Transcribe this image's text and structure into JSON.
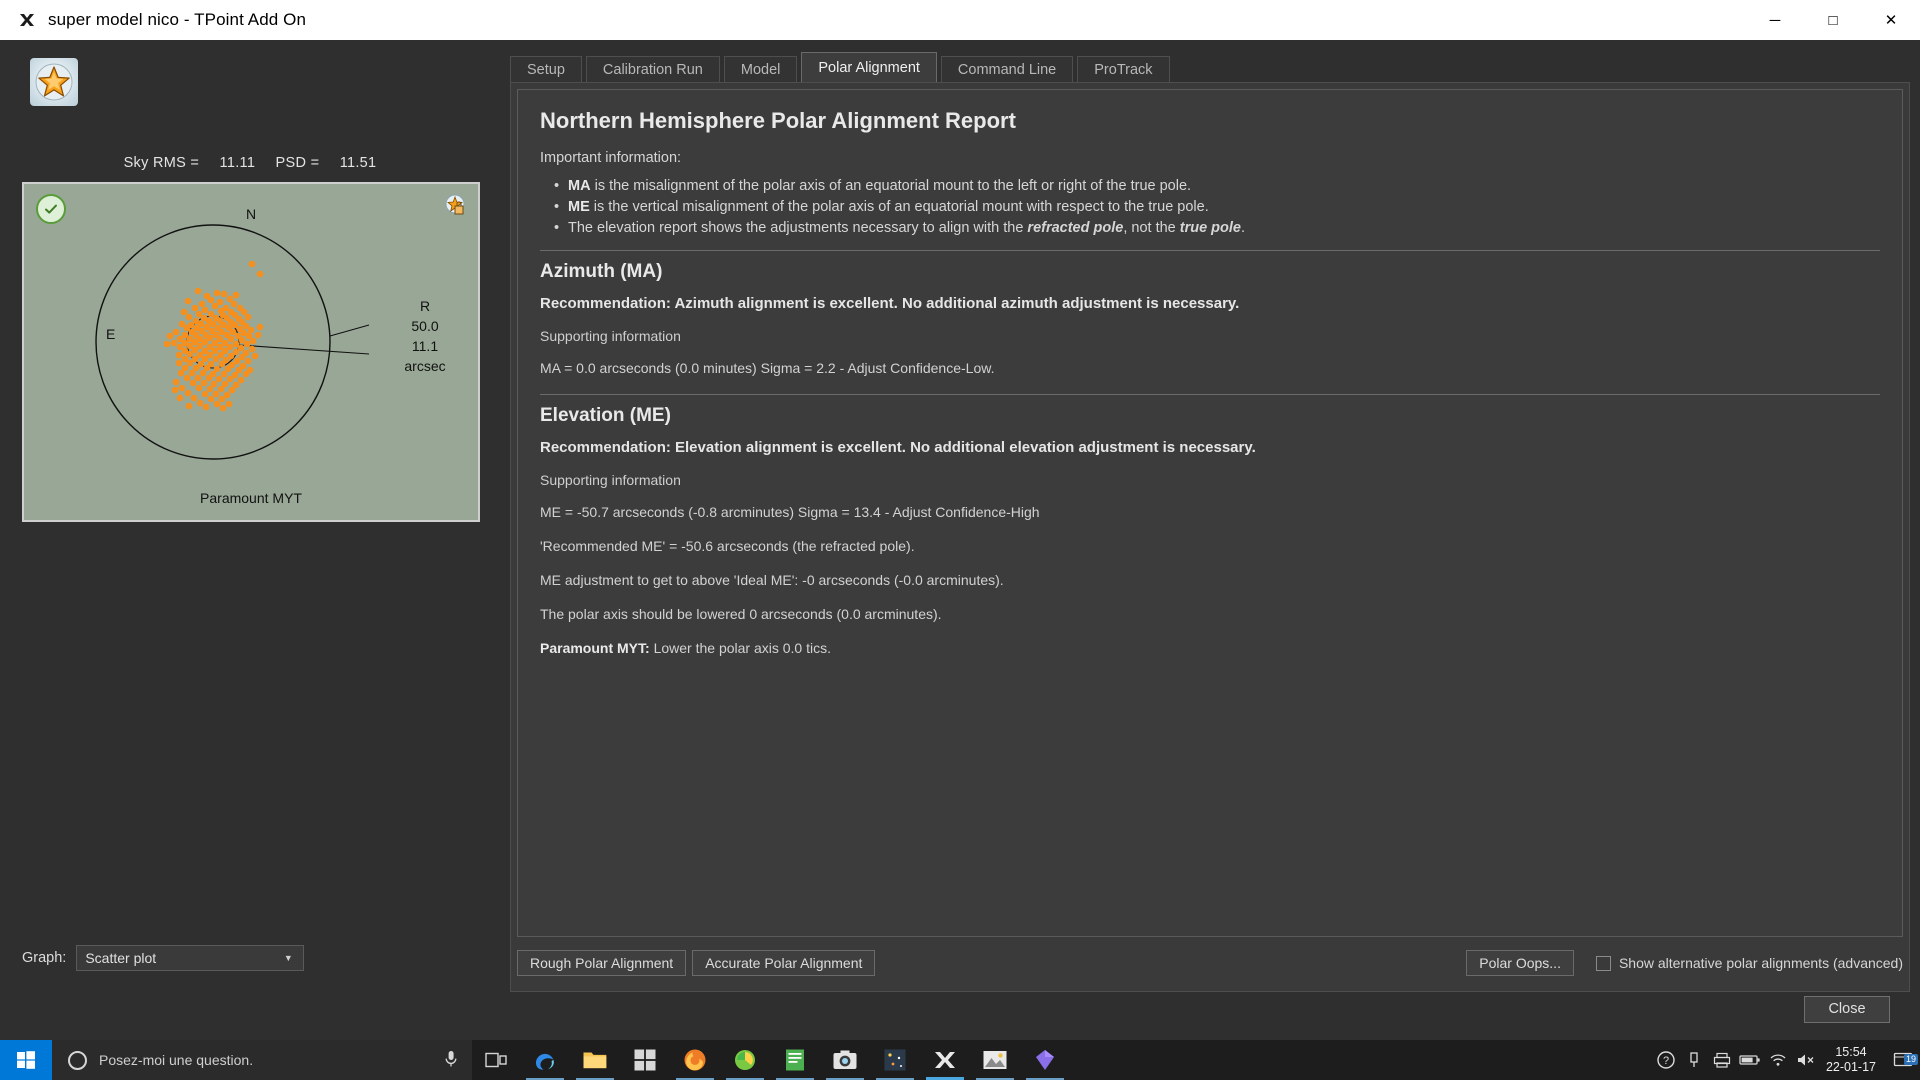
{
  "window": {
    "title": "super model nico - TPoint Add On",
    "icon": "tpoint-x-icon",
    "minimize_label": "─",
    "maximize_label": "□",
    "close_label": "✕"
  },
  "left_panel": {
    "logo_icon": "tpoint-star-logo",
    "stats": {
      "sky_rms_label": "Sky RMS =",
      "sky_rms_value": "11.11",
      "psd_label": "PSD =",
      "psd_value": "11.51"
    },
    "plot": {
      "status_icon": "check-circle-icon",
      "tool_icon": "plot-settings-icon",
      "label_north": "N",
      "label_east": "E",
      "legend_r": "R",
      "legend_outer": "50.0",
      "legend_inner": "11.1",
      "legend_units": "arcsec",
      "caption": "Paramount MYT",
      "background_color": "#99a896",
      "point_color": "#f5901e"
    },
    "graph_selector": {
      "label": "Graph:",
      "value": "Scatter plot",
      "chevron_icon": "chevron-down-icon"
    }
  },
  "tabs": [
    {
      "label": "Setup",
      "active": false
    },
    {
      "label": "Calibration Run",
      "active": false
    },
    {
      "label": "Model",
      "active": false
    },
    {
      "label": "Polar Alignment",
      "active": true
    },
    {
      "label": "Command Line",
      "active": false
    },
    {
      "label": "ProTrack",
      "active": false
    }
  ],
  "report": {
    "title": "Northern Hemisphere Polar Alignment Report",
    "important_label": "Important information:",
    "bullets": [
      {
        "bold": "MA",
        "rest": " is the misalignment of the polar axis of an equatorial mount to the left or right of the true pole."
      },
      {
        "bold": "ME",
        "rest": " is the vertical misalignment of the polar axis of an equatorial mount with respect to the true pole."
      },
      {
        "bold": "",
        "rest": "The elevation report shows the adjustments necessary to align with the ",
        "italic1": "refracted pole",
        "mid": ", not the ",
        "italic2": "true pole",
        "tail": "."
      }
    ],
    "azimuth": {
      "heading": "Azimuth (MA)",
      "recommendation": "Recommendation: Azimuth alignment is excellent. No additional azimuth adjustment is necessary.",
      "supporting_label": "Supporting information",
      "lines": [
        "MA = 0.0 arcseconds (0.0 minutes) Sigma = 2.2 - Adjust Confidence-Low."
      ]
    },
    "elevation": {
      "heading": "Elevation (ME)",
      "recommendation": "Recommendation: Elevation alignment is excellent. No additional elevation adjustment is necessary.",
      "supporting_label": "Supporting information",
      "lines": [
        "ME = -50.7 arcseconds (-0.8 arcminutes) Sigma = 13.4 - Adjust Confidence-High",
        "'Recommended ME' = -50.6 arcseconds (the refracted pole).",
        "ME adjustment to get to above 'Ideal ME': -0 arcseconds (-0.0 arcminutes).",
        "The polar axis should be lowered 0 arcseconds (0.0 arcminutes)."
      ],
      "final_bold": "Paramount MYT:",
      "final_rest": " Lower the polar axis 0.0 tics."
    }
  },
  "bottom_bar": {
    "rough_button": "Rough Polar Alignment",
    "accurate_button": "Accurate Polar Alignment",
    "polar_oops_button": "Polar Oops...",
    "show_alternative_label": "Show alternative polar alignments (advanced)",
    "show_alternative_checked": false
  },
  "dialog_footer": {
    "close_button": "Close"
  },
  "taskbar": {
    "start_icon": "windows-start-icon",
    "search_placeholder": "Posez-moi une question.",
    "search_icon": "search-circle-icon",
    "mic_icon": "microphone-icon",
    "task_view_icon": "task-view-icon",
    "apps": [
      {
        "name": "edge-icon",
        "running": true
      },
      {
        "name": "file-explorer-icon",
        "running": true
      },
      {
        "name": "store-icon",
        "running": false
      },
      {
        "name": "firefox-icon",
        "running": true
      },
      {
        "name": "photo-app-icon",
        "running": true
      },
      {
        "name": "notes-app-icon",
        "running": true
      },
      {
        "name": "camera-app-icon",
        "running": true
      },
      {
        "name": "skychart-app-icon",
        "running": true
      },
      {
        "name": "tpoint-app-icon",
        "active": true
      },
      {
        "name": "image-viewer-icon",
        "running": true
      },
      {
        "name": "gem-app-icon",
        "running": true
      }
    ],
    "tray": [
      {
        "name": "help-icon"
      },
      {
        "name": "usb-icon"
      },
      {
        "name": "printer-icon"
      },
      {
        "name": "battery-icon"
      },
      {
        "name": "wifi-icon"
      },
      {
        "name": "volume-icon"
      }
    ],
    "clock_time": "15:54",
    "clock_date": "22-01-17",
    "notification_icon": "notification-icon",
    "notification_count": "19"
  },
  "chart_data": {
    "type": "scatter",
    "title": "Scatter plot",
    "subtitle": "Paramount MYT",
    "annotations": {
      "sky_rms": 11.11,
      "psd": 11.51
    },
    "axis_labels": {
      "top": "N",
      "left": "E"
    },
    "rings": [
      {
        "label": "R",
        "radius_value": 50.0,
        "units": "arcsec"
      },
      {
        "label": "",
        "radius_value": 11.1,
        "units": "arcsec"
      }
    ],
    "legend_position": "right",
    "grid": false,
    "point_color": "#f5901e",
    "n_points": 420,
    "cluster": {
      "center_x": 0.03,
      "center_y": 0.06,
      "spread_x": 0.1,
      "spread_y": 0.17
    },
    "outliers": [
      {
        "x": 0.28,
        "y": 0.42
      },
      {
        "x": 0.31,
        "y": 0.37
      },
      {
        "x": 0.21,
        "y": 0.29
      }
    ]
  }
}
